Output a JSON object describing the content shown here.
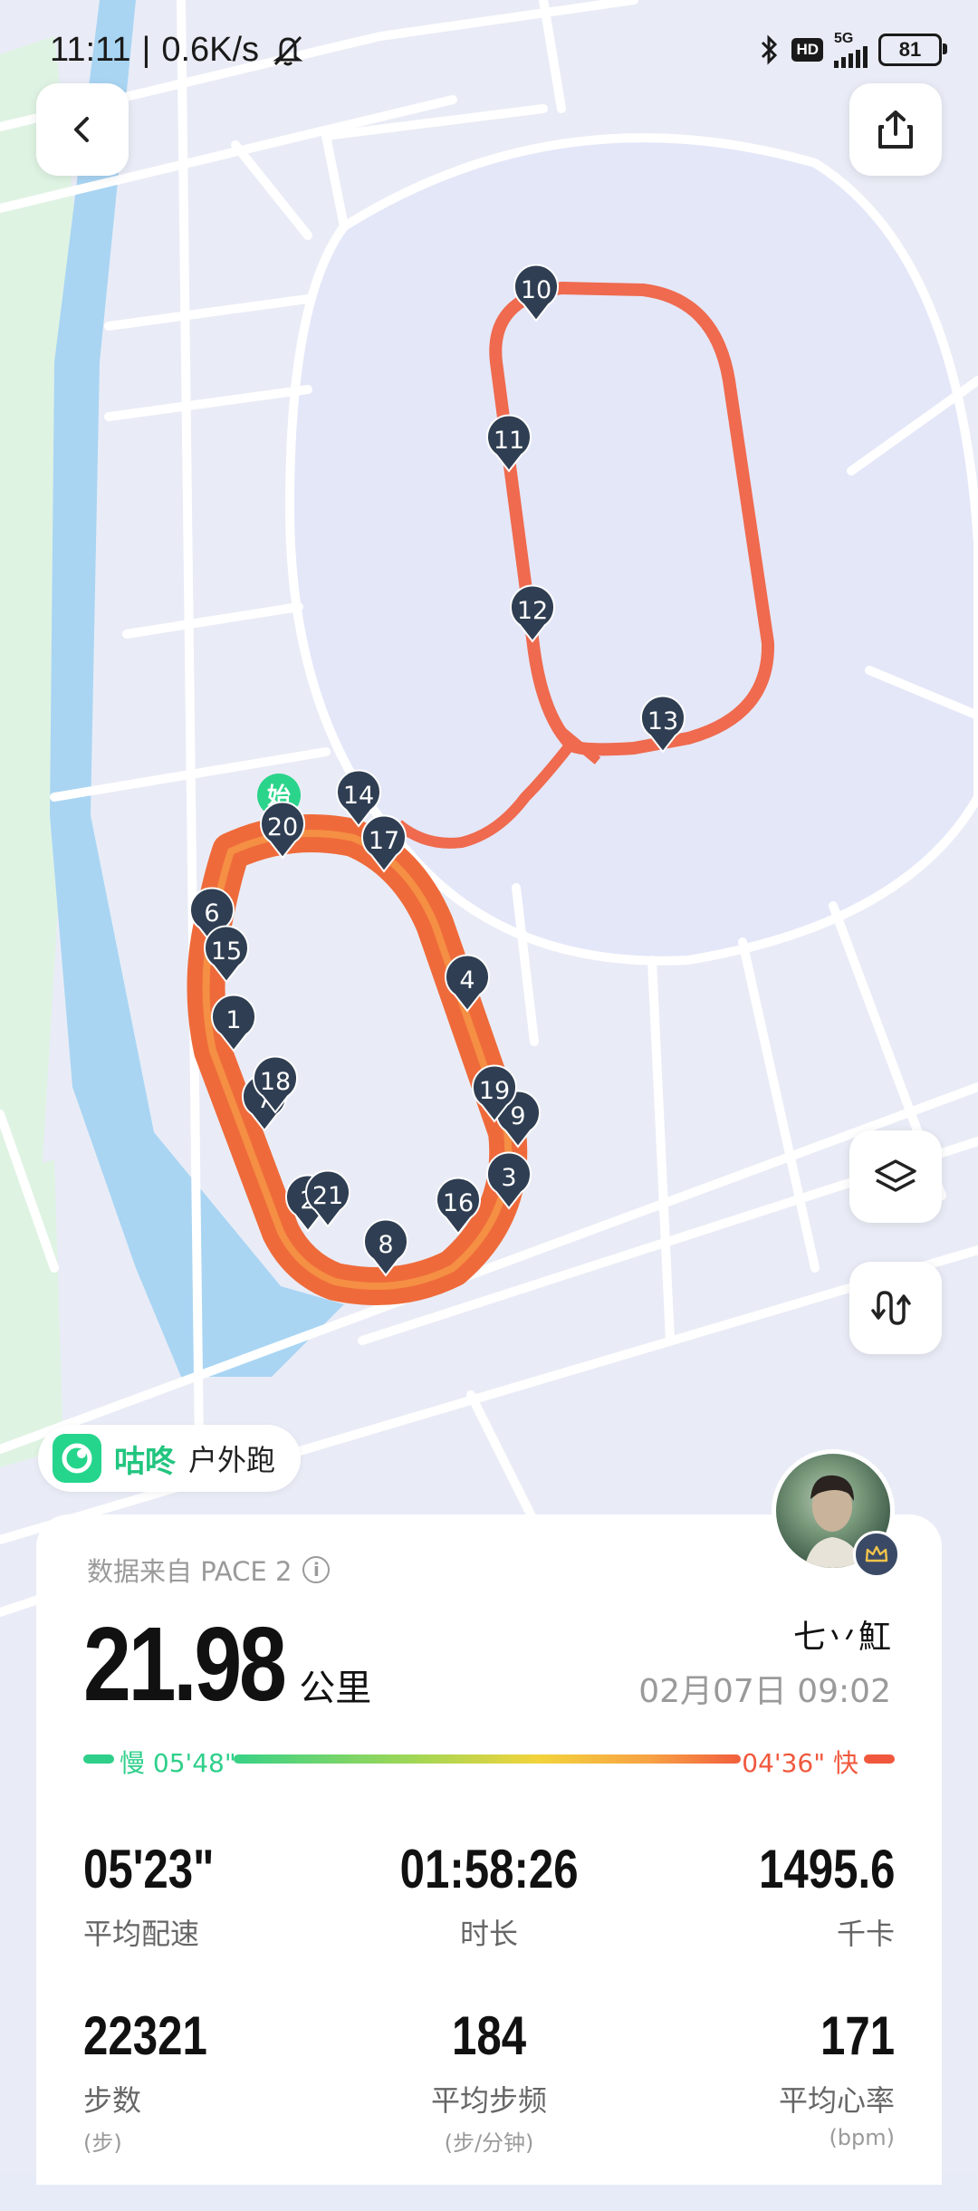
{
  "status_bar": {
    "time": "11:11",
    "speed": "0.6K/s",
    "network": "5G",
    "battery": "81",
    "icons": [
      "mute-bell-icon",
      "bluetooth-icon",
      "hd-icon",
      "signal-icon",
      "battery-icon"
    ]
  },
  "map": {
    "route_color": "#f0583d",
    "pin_color": "#2f3e52",
    "start_label": "始",
    "markers": [
      "1",
      "2",
      "3",
      "4",
      "6",
      "7",
      "8",
      "9",
      "10",
      "11",
      "12",
      "13",
      "14",
      "15",
      "16",
      "17",
      "18",
      "19",
      "20",
      "21"
    ]
  },
  "buttons": {
    "back": "back-icon",
    "share": "share-icon",
    "layers": "layers-icon",
    "track": "track-icon"
  },
  "brand": {
    "name": "咕咚",
    "activity": "户外跑"
  },
  "summary": {
    "source": "数据来自 PACE 2",
    "distance": "21.98",
    "distance_unit": "公里",
    "username": "七丷魟",
    "datetime": "02月07日 09:02",
    "pace_slow_label": "慢 05'48\"",
    "pace_fast_label": "04'36\" 快"
  },
  "stats": [
    {
      "value": "05'23\"",
      "label": "平均配速",
      "unit": ""
    },
    {
      "value": "01:58:26",
      "label": "时长",
      "unit": ""
    },
    {
      "value": "1495.6",
      "label": "千卡",
      "unit": ""
    },
    {
      "value": "22321",
      "label": "步数",
      "unit": "(步)"
    },
    {
      "value": "184",
      "label": "平均步频",
      "unit": "(步/分钟)"
    },
    {
      "value": "171",
      "label": "平均心率",
      "unit": "(bpm)"
    }
  ]
}
